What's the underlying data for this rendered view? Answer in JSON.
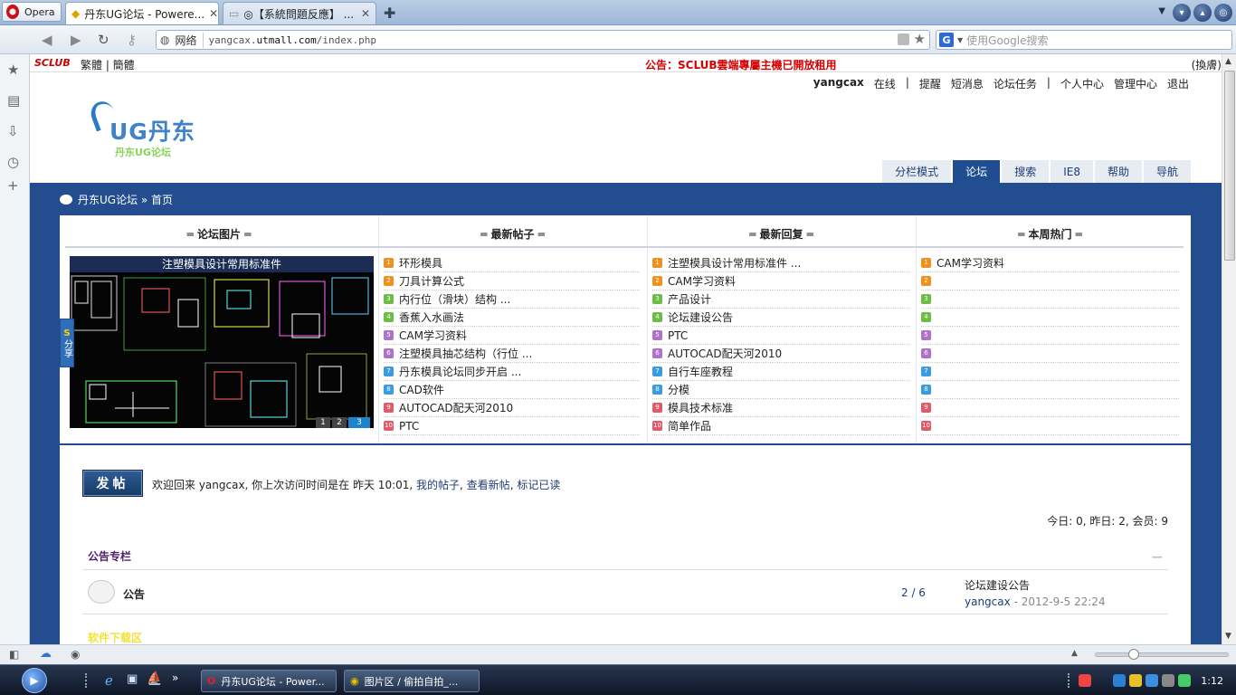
{
  "browser": {
    "menu_button": "Opera",
    "tabs": [
      {
        "title": "丹东UG论坛 - Powere...",
        "active": true
      },
      {
        "title": "◎【系統問題反應】 ...",
        "active": false
      }
    ],
    "address": {
      "zone": "网络",
      "url_prefix": "yangcax.",
      "url_domain": "utmall.com",
      "url_path": "/index.php"
    },
    "search": {
      "engine": "G",
      "placeholder": "使用Google搜索"
    }
  },
  "topstrip": {
    "brand": "SCLUB",
    "lang": "繁體 | 簡體",
    "notice": "公告：SCLUB雲端專屬主機已開放租用",
    "skin": "(換膚)"
  },
  "usernav": [
    "yangcax",
    "在线",
    "|",
    "提醒",
    "短消息",
    "论坛任务",
    "|",
    "个人中心",
    "管理中心",
    "退出"
  ],
  "logo": {
    "main": "UG丹东",
    "sub": "丹东UG论坛"
  },
  "mainnav": [
    {
      "label": "分栏模式",
      "active": false
    },
    {
      "label": "论坛",
      "active": true
    },
    {
      "label": "搜索",
      "active": false
    },
    {
      "label": "IE8",
      "active": false
    },
    {
      "label": "帮助",
      "active": false
    },
    {
      "label": "导航",
      "active": false
    }
  ],
  "breadcrumb": "丹东UG论坛 » 首页",
  "share": "分享",
  "showcase": {
    "heads": [
      "═ 论坛图片 ═",
      "═ 最新帖子 ═",
      "═ 最新回复 ═",
      "═ 本周热门 ═"
    ],
    "picture": {
      "title": "注塑模具设计常用标准件",
      "pages": [
        "1",
        "2",
        "3"
      ],
      "current_page": 3
    },
    "numbers": [
      "1",
      "2",
      "3",
      "4",
      "5",
      "6",
      "7",
      "8",
      "9",
      "10"
    ],
    "num_colors": [
      "#f0901e",
      "#f0901e",
      "#6cbd45",
      "#6cbd45",
      "#b071c8",
      "#b071c8",
      "#3a9be0",
      "#3a9be0",
      "#e05a6a",
      "#e05a6a"
    ],
    "new_posts": [
      "环形模具",
      "刀具计算公式",
      "内行位（滑块）结构 ...",
      "香蕉入水画法",
      "CAM学习资料",
      "注塑模具抽芯结构（行位 ...",
      "丹东模具论坛同步开启 ...",
      "CAD软件",
      "AUTOCAD配天河2010",
      "PTC"
    ],
    "new_replies": [
      "注塑模具设计常用标准件 ...",
      "CAM学习资料",
      "产品设计",
      "论坛建设公告",
      "PTC",
      "AUTOCAD配天河2010",
      "自行车座教程",
      "分模",
      "模具技术标准",
      "简单作品"
    ],
    "hot_week": [
      "CAM学习资料",
      "",
      "",
      "",
      "",
      "",
      "",
      "",
      "",
      ""
    ]
  },
  "welcome": {
    "post_button": "发帖",
    "text": "欢迎回来 yangcax, 你上次访问时间是在 昨天 10:01, ",
    "links": [
      "我的帖子",
      "查看新帖",
      "标记已读"
    ]
  },
  "stats": "今日: 0, 昨日: 2, 会员: 9",
  "sections": [
    {
      "title": "公告专栏"
    },
    {
      "title": "软件下载区"
    }
  ],
  "forum": {
    "name": "公告",
    "count": "2 / 6",
    "last_title": "论坛建设公告",
    "last_user": "yangcax",
    "last_time": "- 2012-9-5 22:24"
  },
  "taskbar": {
    "tasks": [
      "丹东UG论坛 - Power...",
      "图片区 / 偷拍自拍_..."
    ],
    "clock": "1:12"
  }
}
